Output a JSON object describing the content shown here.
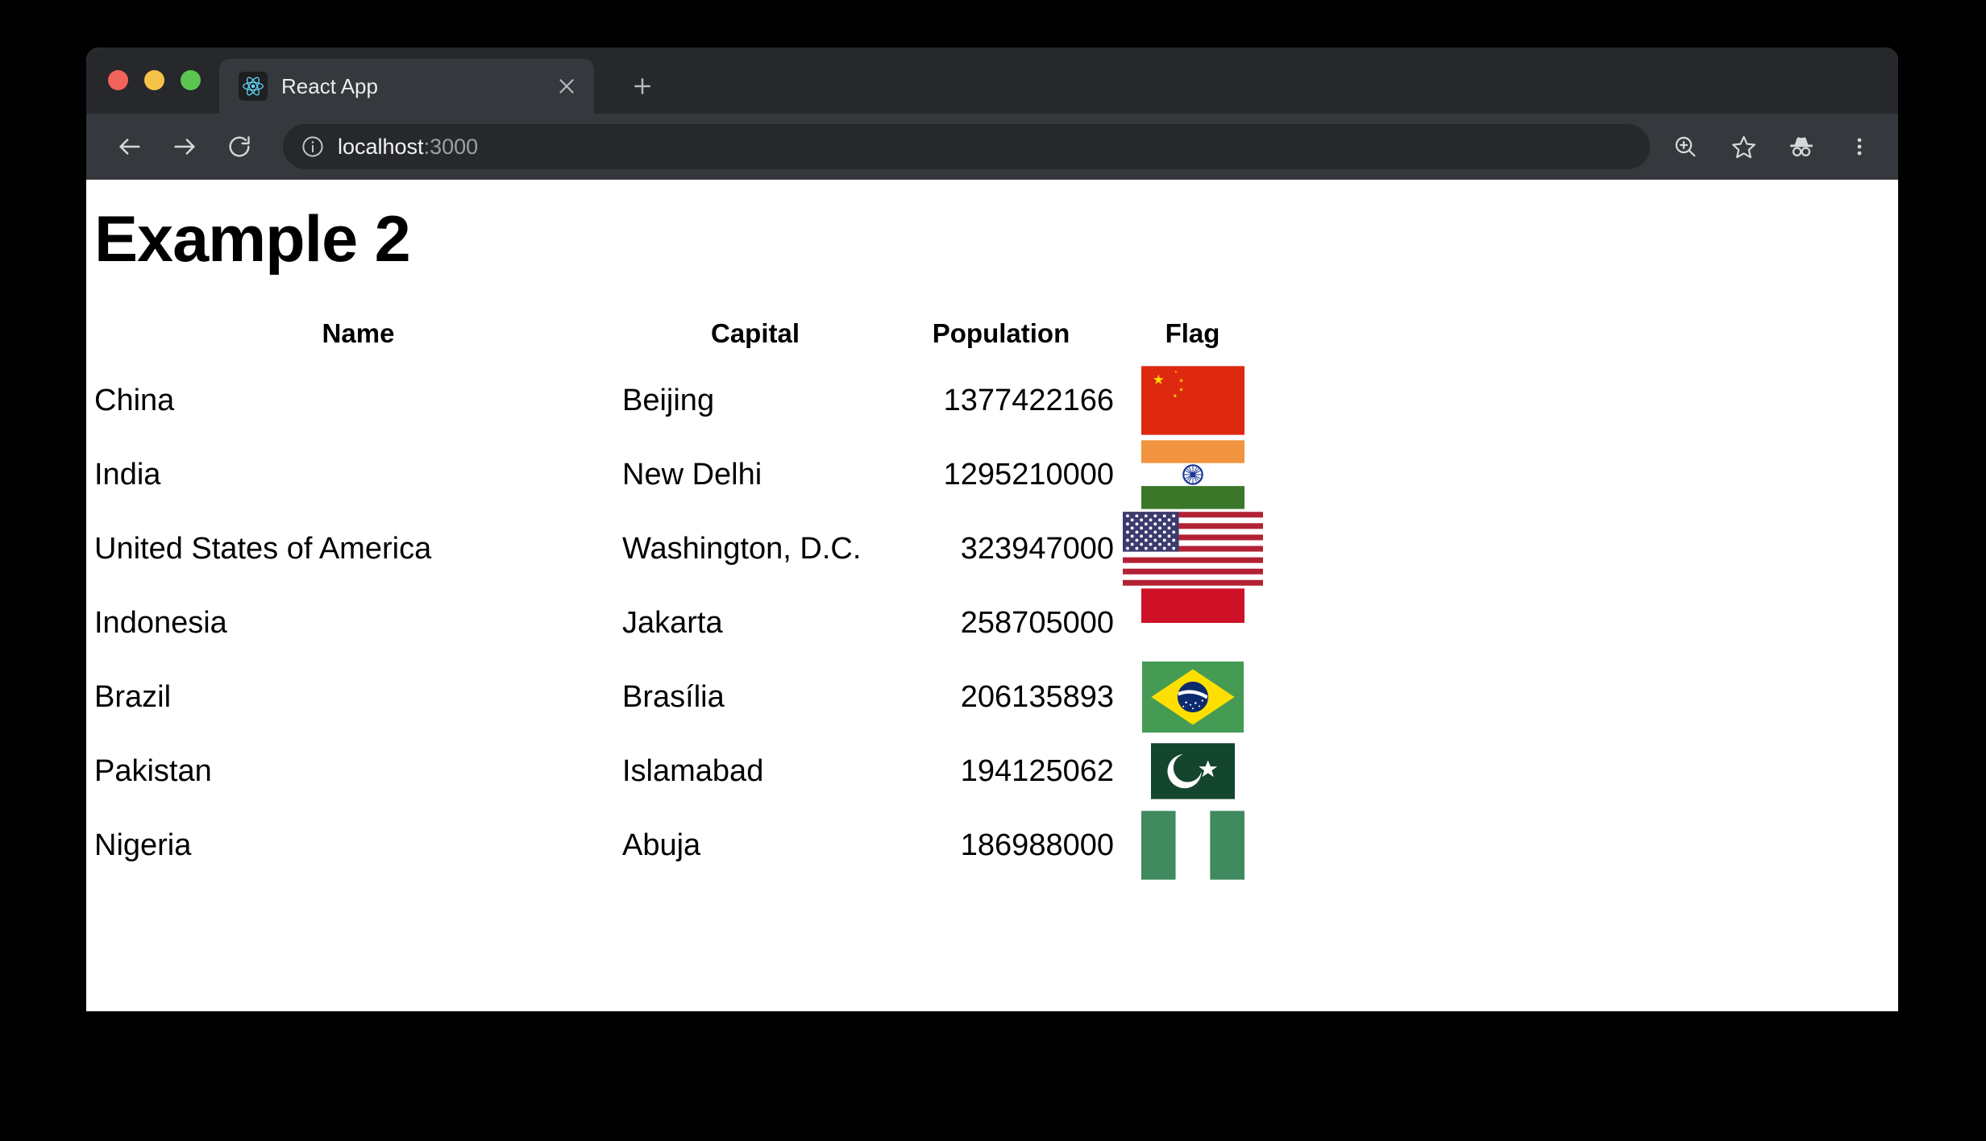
{
  "browser": {
    "tab": {
      "title": "React App",
      "favicon_icon": "react-logo-icon",
      "close_icon": "close-icon"
    },
    "new_tab_icon": "plus-icon",
    "toolbar": {
      "back_icon": "arrow-left-icon",
      "forward_icon": "arrow-right-icon",
      "reload_icon": "reload-icon",
      "info_icon": "info-circle-icon",
      "url_host": "localhost",
      "url_port": ":3000",
      "zoom_icon": "zoom-in-icon",
      "bookmark_icon": "star-icon",
      "incognito_icon": "incognito-icon",
      "menu_icon": "three-dots-vertical-icon"
    },
    "traffic_lights": {
      "close": "close-window-button",
      "minimize": "minimize-window-button",
      "maximize": "maximize-window-button"
    }
  },
  "page": {
    "title": "Example 2",
    "table": {
      "columns": [
        "Name",
        "Capital",
        "Population",
        "Flag"
      ],
      "rows": [
        {
          "name": "China",
          "capital": "Beijing",
          "population": "1377422166",
          "flag": "cn"
        },
        {
          "name": "India",
          "capital": "New Delhi",
          "population": "1295210000",
          "flag": "in"
        },
        {
          "name": "United States of America",
          "capital": "Washington, D.C.",
          "population": "323947000",
          "flag": "us"
        },
        {
          "name": "Indonesia",
          "capital": "Jakarta",
          "population": "258705000",
          "flag": "id"
        },
        {
          "name": "Brazil",
          "capital": "Brasília",
          "population": "206135893",
          "flag": "br"
        },
        {
          "name": "Pakistan",
          "capital": "Islamabad",
          "population": "194125062",
          "flag": "pk"
        },
        {
          "name": "Nigeria",
          "capital": "Abuja",
          "population": "186988000",
          "flag": "ng"
        }
      ]
    }
  },
  "colors": {
    "tab_strip": "#26282b",
    "toolbar": "#35383c",
    "omnibox": "#26282b",
    "page_background": "#ffffff",
    "text": "#000000",
    "traffic_red": "#f2635c",
    "traffic_yellow": "#f6c348",
    "traffic_green": "#5cc653",
    "flag_cn_red": "#de2910",
    "flag_cn_yellow": "#ffde00",
    "flag_in_saffron": "#f0943f",
    "flag_in_green": "#3a7728",
    "flag_in_chakra": "#1b3695",
    "flag_us_blue": "#3c3b6e",
    "flag_us_red": "#b22234",
    "flag_id_red": "#ce1126",
    "flag_br_green": "#459a54",
    "flag_br_yellow": "#fedf00",
    "flag_br_blue": "#0d2a6e",
    "flag_pk_green": "#13462c",
    "flag_ng_green": "#3f8a5e"
  }
}
